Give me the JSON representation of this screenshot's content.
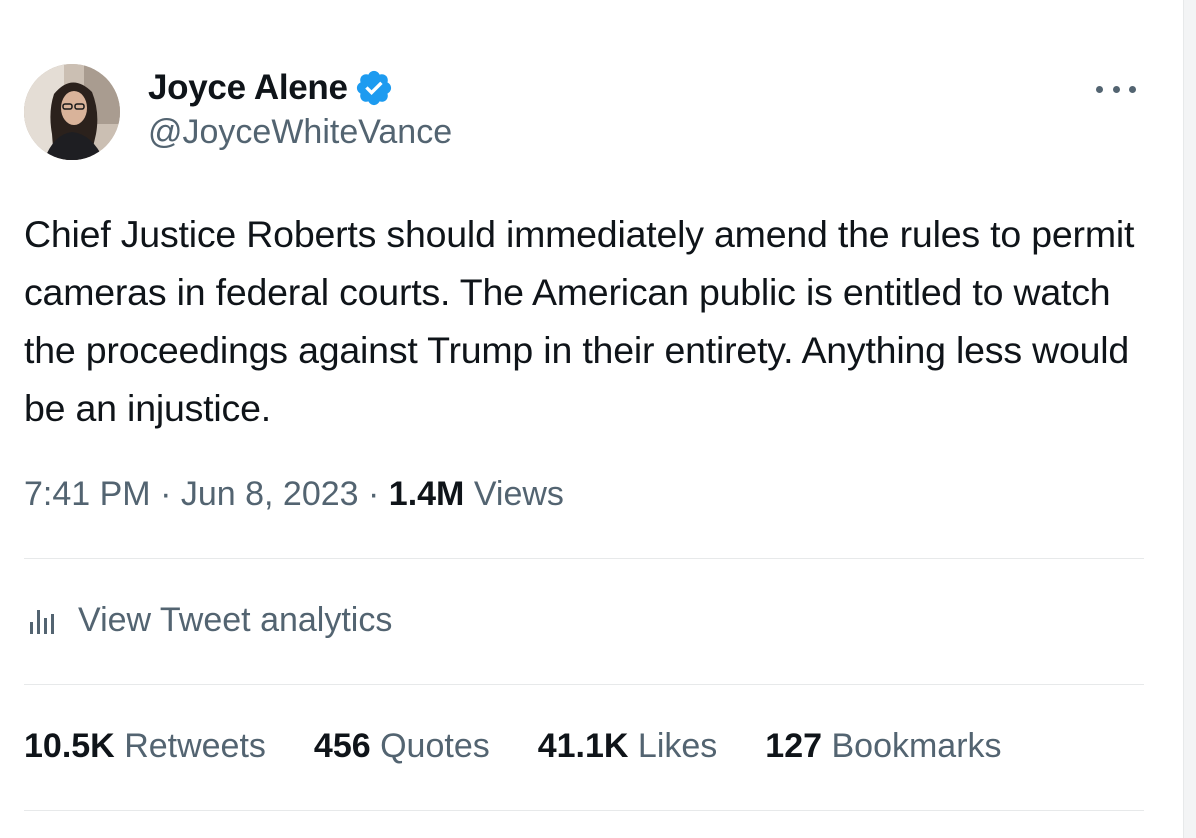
{
  "author": {
    "display_name": "Joyce Alene",
    "handle": "@JoyceWhiteVance",
    "verified_icon": "verified-badge-icon",
    "verified_color": "#1d9bf0"
  },
  "tweet": {
    "text": "Chief Justice Roberts should immediately amend the rules to permit cameras in federal courts. The American public is entitled to watch the proceedings against Trump in their entirety. Anything less would be an injustice."
  },
  "meta": {
    "time": "7:41 PM",
    "separator": "·",
    "date": "Jun 8, 2023",
    "views_count": "1.4M",
    "views_label": "Views"
  },
  "analytics": {
    "label": "View Tweet analytics",
    "icon": "bar-chart-icon"
  },
  "stats": [
    {
      "count": "10.5K",
      "label": "Retweets"
    },
    {
      "count": "456",
      "label": "Quotes"
    },
    {
      "count": "41.1K",
      "label": "Likes"
    },
    {
      "count": "127",
      "label": "Bookmarks"
    }
  ],
  "colors": {
    "primary_text": "#0f1419",
    "secondary_text": "#536471",
    "divider": "#e7e9ea"
  }
}
